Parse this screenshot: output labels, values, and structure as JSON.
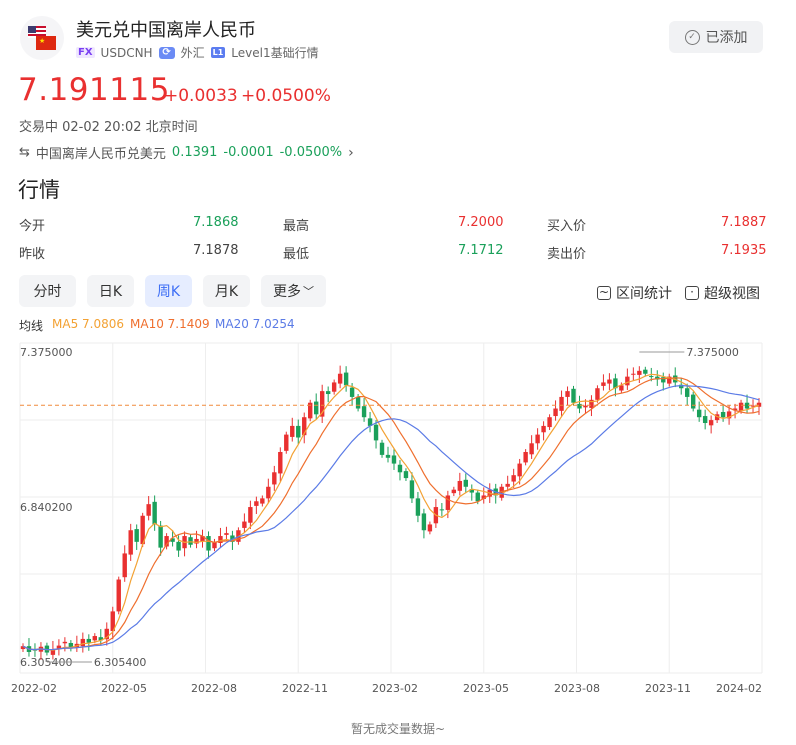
{
  "header": {
    "title": "美元兑中国离岸人民币",
    "fx_tag": "FX",
    "symbol": "USDCNH",
    "category": "外汇",
    "level_tag": "L1",
    "level": "Level1基础行情",
    "added_label": "已添加"
  },
  "quote": {
    "price": "7.191115",
    "change": "+0.0033",
    "change_pct": "+0.0500%",
    "status_time": "交易中 02-02 20:02 北京时间"
  },
  "related": {
    "name": "中国离岸人民币兑美元",
    "price": "0.1391",
    "change": "-0.0001",
    "change_pct": "-0.0500%"
  },
  "section_title": "行情",
  "stats": {
    "open_label": "今开",
    "open": "7.1868",
    "high_label": "最高",
    "high": "7.2000",
    "bid_label": "买入价",
    "bid": "7.1887",
    "prev_label": "昨收",
    "prev": "7.1878",
    "low_label": "最低",
    "low": "7.1712",
    "ask_label": "卖出价",
    "ask": "7.1935"
  },
  "tabs": [
    "分时",
    "日K",
    "周K",
    "月K",
    "更多"
  ],
  "active_tab": "周K",
  "tools": {
    "range_stats": "区间统计",
    "super_view": "超级视图"
  },
  "ma_legend": {
    "label": "均线",
    "ma5": "MA5 7.0806",
    "ma10": "MA10 7.1409",
    "ma20": "MA20 7.0254"
  },
  "colors": {
    "up": "#e93030",
    "down": "#1aa05a",
    "ma5": "#f3a234",
    "ma10": "#ef6f2e",
    "ma20": "#5b7be6",
    "price_line": "#f08a3c"
  },
  "footer": "暂无成交量数据~",
  "chart_data": {
    "type": "candlestick",
    "interval": "weekly",
    "x_ticks": [
      "2022-02",
      "2022-05",
      "2022-08",
      "2022-11",
      "2023-02",
      "2023-05",
      "2023-08",
      "2023-11",
      "2024-02"
    ],
    "y_ticks": [
      "7.375000",
      "6.840200",
      "6.305400"
    ],
    "ylim": [
      6.3054,
      7.375
    ],
    "max_label": "7.375000",
    "min_label": "6.305400",
    "current_price": 7.191115,
    "closes": [
      6.36,
      6.34,
      6.345,
      6.358,
      6.338,
      6.35,
      6.362,
      6.375,
      6.352,
      6.368,
      6.385,
      6.372,
      6.395,
      6.38,
      6.42,
      6.48,
      6.59,
      6.68,
      6.76,
      6.72,
      6.81,
      6.85,
      6.78,
      6.7,
      6.74,
      6.72,
      6.69,
      6.74,
      6.71,
      6.73,
      6.74,
      6.69,
      6.72,
      6.74,
      6.75,
      6.72,
      6.76,
      6.79,
      6.84,
      6.86,
      6.87,
      6.91,
      6.96,
      7.03,
      7.09,
      7.12,
      7.08,
      7.15,
      7.2,
      7.16,
      7.24,
      7.23,
      7.27,
      7.3,
      7.26,
      7.22,
      7.18,
      7.15,
      7.12,
      7.07,
      7.02,
      7.01,
      6.99,
      6.96,
      6.94,
      6.87,
      6.81,
      6.76,
      6.78,
      6.84,
      6.83,
      6.88,
      6.9,
      6.93,
      6.91,
      6.89,
      6.86,
      6.88,
      6.9,
      6.88,
      6.91,
      6.92,
      6.95,
      6.99,
      7.03,
      7.06,
      7.09,
      7.12,
      7.15,
      7.18,
      7.22,
      7.24,
      7.2,
      7.18,
      7.19,
      7.21,
      7.25,
      7.27,
      7.28,
      7.25,
      7.26,
      7.29,
      7.3,
      7.31,
      7.3,
      7.29,
      7.28,
      7.27,
      7.29,
      7.27,
      7.25,
      7.22,
      7.18,
      7.15,
      7.13,
      7.14,
      7.16,
      7.15,
      7.17,
      7.18,
      7.2,
      7.18,
      7.19,
      7.2
    ],
    "ma5_last": 7.0806,
    "ma10_last": 7.1409,
    "ma20_last": 7.0254
  }
}
